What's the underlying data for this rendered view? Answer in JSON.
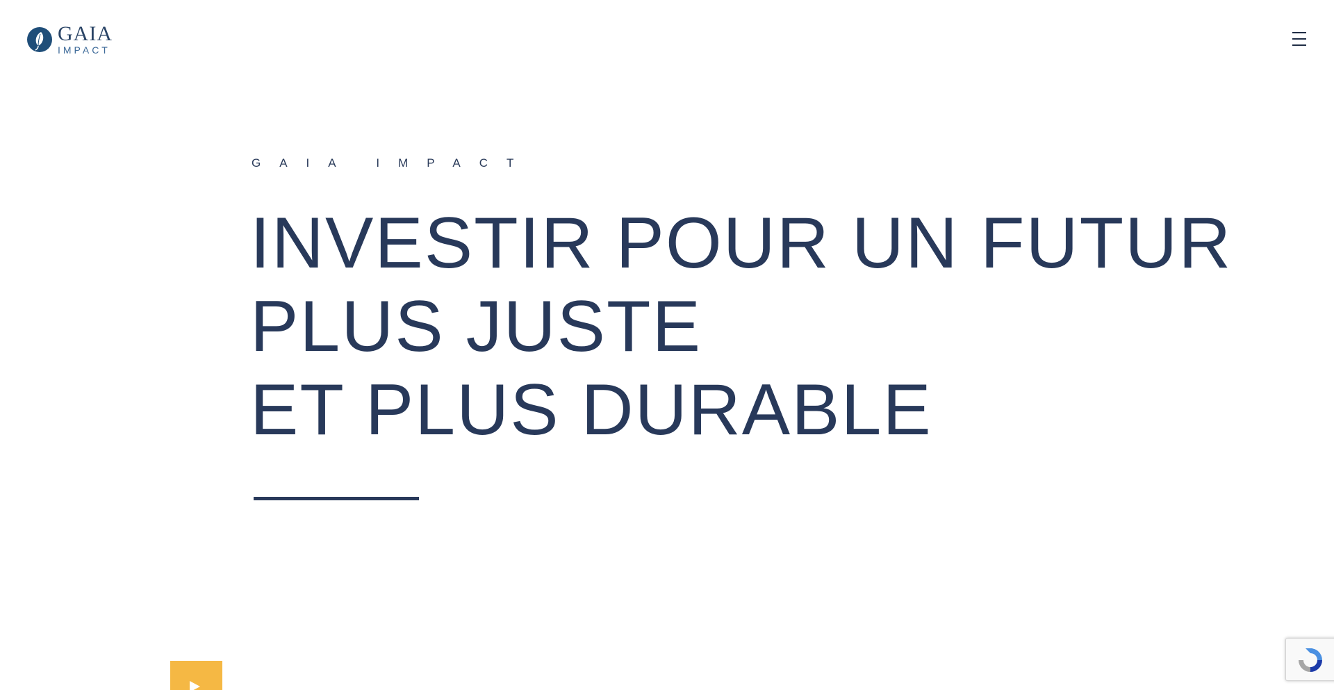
{
  "header": {
    "logo": {
      "name": "GAIA",
      "subtitle": "IMPACT",
      "icon": "leaf-icon"
    },
    "menu_icon": "hamburger-menu-icon"
  },
  "hero": {
    "eyebrow": "GAIA IMPACT",
    "headline_lines": [
      "INVESTIR POUR UN FUTUR",
      "PLUS JUSTE",
      "ET PLUS DURABLE"
    ]
  },
  "video": {
    "icon": "play-icon"
  },
  "recaptcha": {
    "icon": "recaptcha-icon"
  },
  "colors": {
    "text_primary": "#28395a",
    "logo_blue": "#1f4e79",
    "accent_yellow": "#f5b844",
    "background": "#ffffff"
  }
}
